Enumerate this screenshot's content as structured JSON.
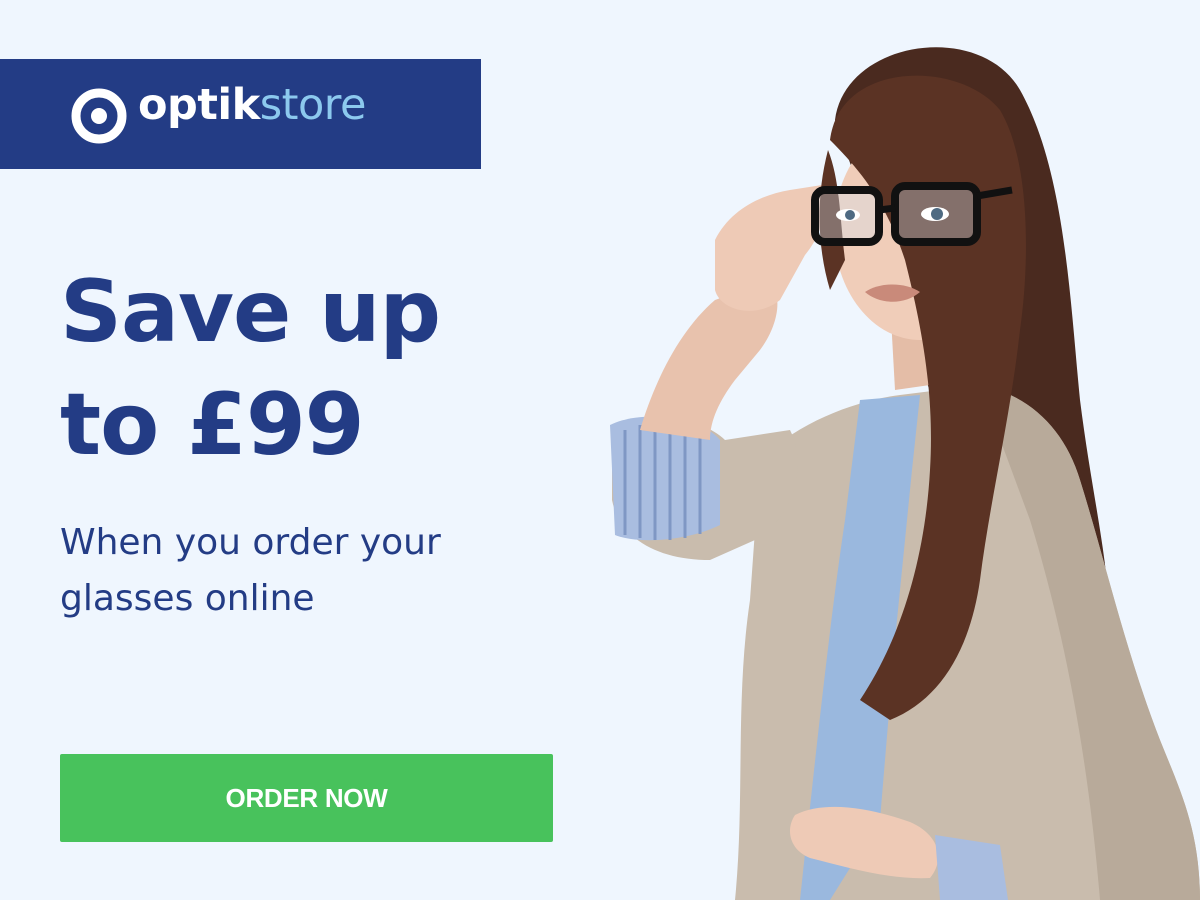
{
  "brand": {
    "name_bold": "optik",
    "name_light": "store",
    "logo_icon": "target-ring-icon",
    "colors": {
      "navy": "#233c85",
      "light_blue": "#8cc9ee",
      "white": "#ffffff"
    }
  },
  "headline": {
    "line1": "Save up",
    "line2": "to £99"
  },
  "subheadline": {
    "line1": "When you order your",
    "line2": "glasses online"
  },
  "cta": {
    "label": "ORDER NOW",
    "color": "#48c25c"
  },
  "background_color": "#eff6fe",
  "model_image": "woman-wearing-glasses-photo"
}
